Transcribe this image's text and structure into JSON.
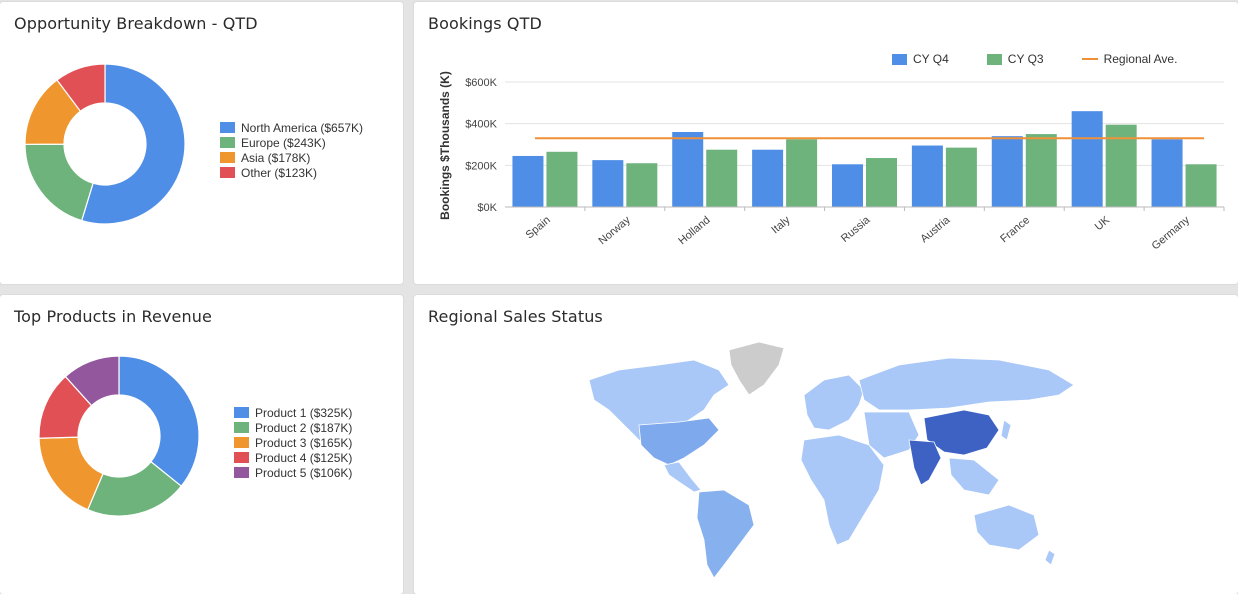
{
  "colors": {
    "blue": "#4f8ee6",
    "green": "#6db37b",
    "orange": "#f0962e",
    "red": "#e05055",
    "purple": "#93579e",
    "line": "#f0913a"
  },
  "opportunity": {
    "title": "Opportunity Breakdown - QTD",
    "legend": [
      {
        "label": "North America ($657K)",
        "color": "#4f8ee6",
        "icon": "swatch"
      },
      {
        "label": "Europe ($243K)",
        "color": "#6db37b",
        "icon": "swatch"
      },
      {
        "label": "Asia ($178K)",
        "color": "#f0962e",
        "icon": "swatch"
      },
      {
        "label": "Other ($123K)",
        "color": "#e05055",
        "icon": "swatch"
      }
    ],
    "chart_data": {
      "type": "pie",
      "categories": [
        "North America",
        "Europe",
        "Asia",
        "Other"
      ],
      "values": [
        657,
        243,
        178,
        123
      ]
    }
  },
  "bookings": {
    "title": "Bookings QTD",
    "legend": {
      "cy_q4": "CY Q4",
      "cy_q3": "CY Q3",
      "regional_ave": "Regional Ave."
    },
    "chart_data": {
      "type": "bar",
      "ylabel": "Bookings $Thousands (K)",
      "ylim": [
        0,
        600
      ],
      "yticks": [
        "$0K",
        "$200K",
        "$400K",
        "$600K"
      ],
      "categories": [
        "Spain",
        "Norway",
        "Holland",
        "Italy",
        "Russia",
        "Austria",
        "France",
        "UK",
        "Germany"
      ],
      "series": [
        {
          "name": "CY Q4",
          "values": [
            245,
            225,
            360,
            275,
            205,
            295,
            340,
            460,
            325
          ]
        },
        {
          "name": "CY Q3",
          "values": [
            265,
            210,
            275,
            325,
            235,
            285,
            350,
            395,
            205
          ]
        }
      ],
      "line": {
        "name": "Regional Ave.",
        "value": 330
      }
    }
  },
  "products": {
    "title": "Top Products in Revenue",
    "legend": [
      {
        "label": "Product 1 ($325K)",
        "color": "#4f8ee6",
        "icon": "swatch"
      },
      {
        "label": "Product 2 ($187K)",
        "color": "#6db37b",
        "icon": "swatch"
      },
      {
        "label": "Product 3 ($165K)",
        "color": "#f0962e",
        "icon": "swatch"
      },
      {
        "label": "Product 4 ($125K)",
        "color": "#e05055",
        "icon": "swatch"
      },
      {
        "label": "Product 5 ($106K)",
        "color": "#93579e",
        "icon": "swatch"
      }
    ],
    "chart_data": {
      "type": "pie",
      "categories": [
        "Product 1",
        "Product 2",
        "Product 3",
        "Product 4",
        "Product 5"
      ],
      "values": [
        325,
        187,
        165,
        125,
        106
      ]
    }
  },
  "regional": {
    "title": "Regional Sales Status",
    "map_icon": "world-map"
  }
}
